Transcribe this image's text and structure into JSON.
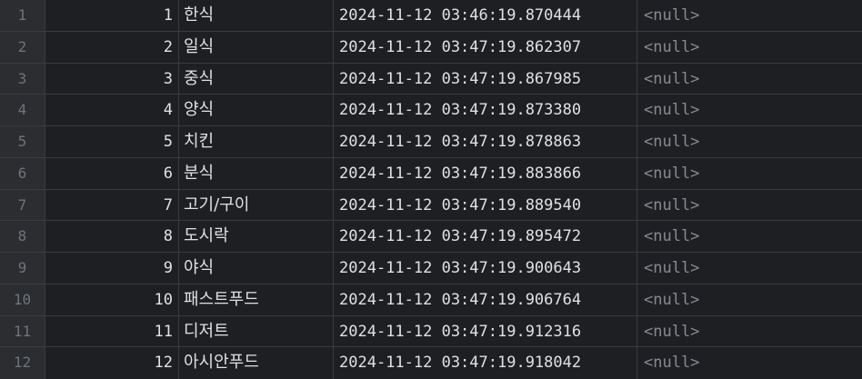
{
  "rows": [
    {
      "n": "1",
      "id": "1",
      "name": "한식",
      "ts": "2024-11-12 03:46:19.870444",
      "val": "<null>"
    },
    {
      "n": "2",
      "id": "2",
      "name": "일식",
      "ts": "2024-11-12 03:47:19.862307",
      "val": "<null>"
    },
    {
      "n": "3",
      "id": "3",
      "name": "중식",
      "ts": "2024-11-12 03:47:19.867985",
      "val": "<null>"
    },
    {
      "n": "4",
      "id": "4",
      "name": "양식",
      "ts": "2024-11-12 03:47:19.873380",
      "val": "<null>"
    },
    {
      "n": "5",
      "id": "5",
      "name": "치킨",
      "ts": "2024-11-12 03:47:19.878863",
      "val": "<null>"
    },
    {
      "n": "6",
      "id": "6",
      "name": "분식",
      "ts": "2024-11-12 03:47:19.883866",
      "val": "<null>"
    },
    {
      "n": "7",
      "id": "7",
      "name": "고기/구이",
      "ts": "2024-11-12 03:47:19.889540",
      "val": "<null>"
    },
    {
      "n": "8",
      "id": "8",
      "name": "도시락",
      "ts": "2024-11-12 03:47:19.895472",
      "val": "<null>"
    },
    {
      "n": "9",
      "id": "9",
      "name": "야식",
      "ts": "2024-11-12 03:47:19.900643",
      "val": "<null>"
    },
    {
      "n": "10",
      "id": "10",
      "name": "패스트푸드",
      "ts": "2024-11-12 03:47:19.906764",
      "val": "<null>"
    },
    {
      "n": "11",
      "id": "11",
      "name": "디저트",
      "ts": "2024-11-12 03:47:19.912316",
      "val": "<null>"
    },
    {
      "n": "12",
      "id": "12",
      "name": "아시안푸드",
      "ts": "2024-11-12 03:47:19.918042",
      "val": "<null>"
    }
  ]
}
